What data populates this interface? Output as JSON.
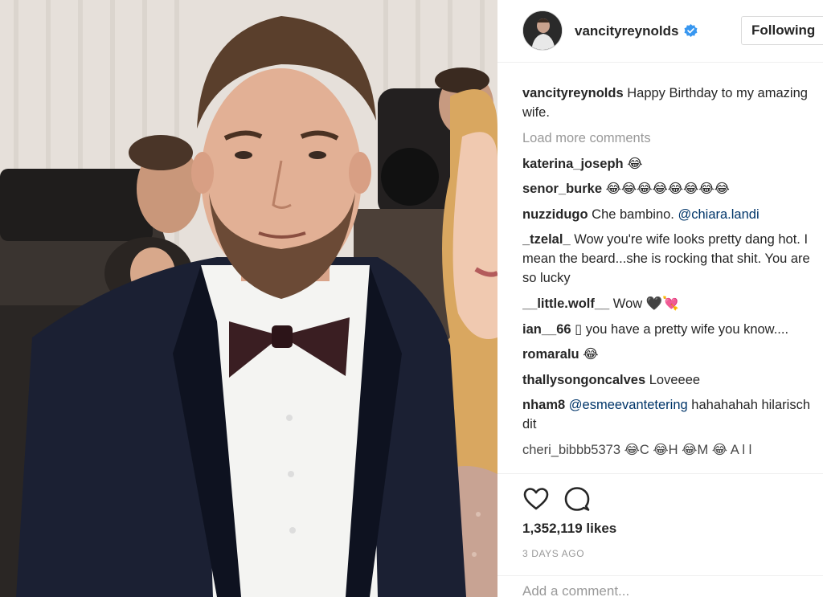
{
  "post": {
    "username": "vancityreynolds",
    "follow_label": "Following",
    "caption": {
      "user": "vancityreynolds",
      "text": "Happy Birthday to my amazing wife."
    },
    "load_more": "Load more comments",
    "comments": [
      {
        "user": "katerina_joseph",
        "text": "😂",
        "mention": ""
      },
      {
        "user": "senor_burke",
        "text": "😂😂😂😂😂😂😂😂",
        "mention": ""
      },
      {
        "user": "nuzzidugo",
        "text": "Che bambino.",
        "mention": "@chiara.landi"
      },
      {
        "user": "_tzelal_",
        "text": "Wow you're wife looks pretty dang hot. I mean the beard...she is rocking that shit. You are so lucky",
        "mention": ""
      },
      {
        "user": "__little.wolf__",
        "text": "Wow 🖤💘",
        "mention": ""
      },
      {
        "user": "ian__66",
        "text": "▯ you have a pretty wife you know....",
        "mention": ""
      },
      {
        "user": "romaralu",
        "text": "😂",
        "mention": ""
      },
      {
        "user": "thallysongoncalves",
        "text": "Loveeee",
        "mention": ""
      },
      {
        "user": "nham8",
        "text": "hahahahah hilarisch dit",
        "mention": "@esmeevantetering"
      }
    ],
    "cut_off_comment": "cheri_bibbb5373 😂C 😂H 😂M 😂 A l l",
    "likes": "1,352,119 likes",
    "age": "3 DAYS AGO",
    "add_comment_placeholder": "Add a comment..."
  },
  "colors": {
    "verified": "#3897f0",
    "mention": "#003569",
    "muted": "#999999"
  },
  "icons": [
    "heart-icon",
    "comment-icon",
    "verified-badge-icon"
  ]
}
